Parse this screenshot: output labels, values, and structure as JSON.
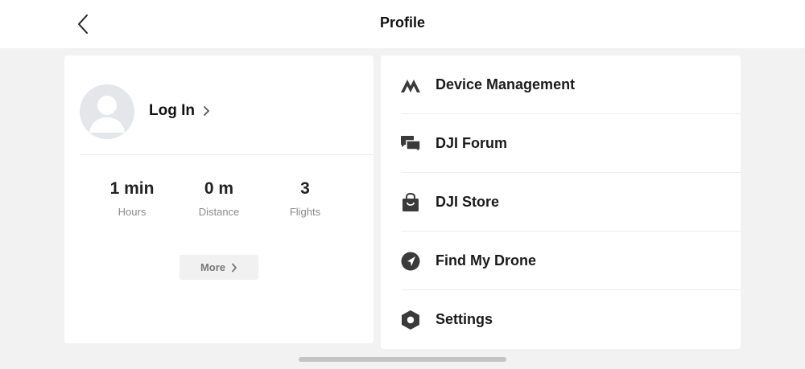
{
  "header": {
    "title": "Profile"
  },
  "profile": {
    "login_label": "Log In"
  },
  "stats": [
    {
      "value": "1 min",
      "label": "Hours"
    },
    {
      "value": "0 m",
      "label": "Distance"
    },
    {
      "value": "3",
      "label": "Flights"
    }
  ],
  "more_label": "More",
  "menu": [
    {
      "label": "Device Management",
      "icon": "device-management-icon"
    },
    {
      "label": "DJI Forum",
      "icon": "forum-icon"
    },
    {
      "label": "DJI Store",
      "icon": "store-bag-icon"
    },
    {
      "label": "Find My Drone",
      "icon": "locate-arrow-icon"
    },
    {
      "label": "Settings",
      "icon": "settings-hexagon-icon"
    }
  ],
  "colors": {
    "background": "#f2f2f3",
    "card": "#ffffff",
    "text": "#1a1a1a",
    "muted": "#8a8a8a",
    "icon": "#3a3a3a"
  }
}
